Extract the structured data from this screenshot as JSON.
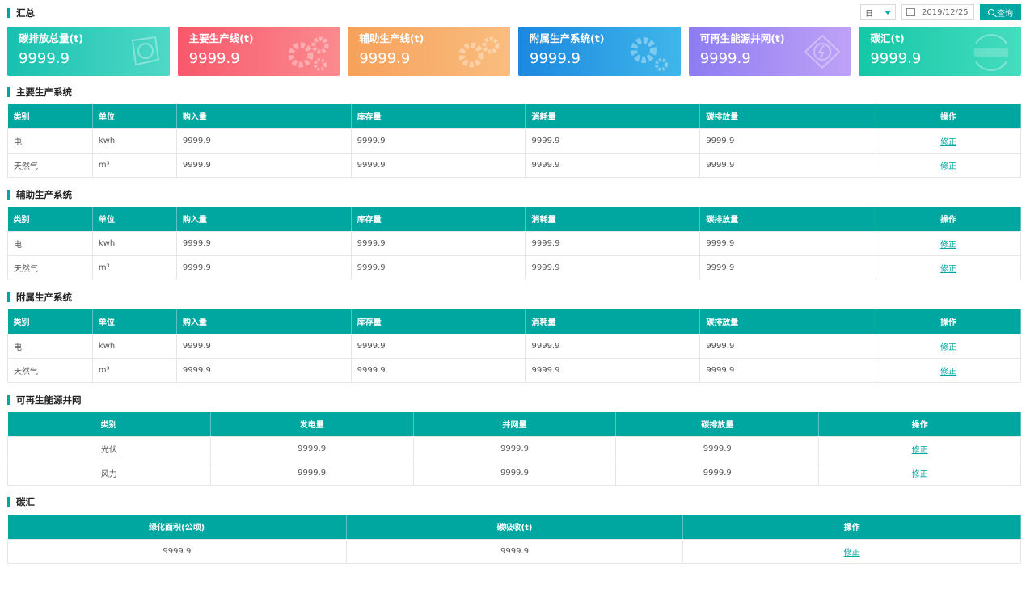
{
  "summary": {
    "title": "汇总",
    "period_select": "日",
    "date": "2019/12/25",
    "query_label": "查询",
    "cards": [
      {
        "title": "碳排放总量(t)",
        "value": "9999.9",
        "icon": "carbon-icon",
        "color": "#19c1b0"
      },
      {
        "title": "主要生产线(t)",
        "value": "9999.9",
        "icon": "gears-icon",
        "color": "#f7586a"
      },
      {
        "title": "辅助生产线(t)",
        "value": "9999.9",
        "icon": "gears-icon",
        "color": "#f7a15a"
      },
      {
        "title": "附属生产系统(t)",
        "value": "9999.9",
        "icon": "gears-icon",
        "color": "#1c88df"
      },
      {
        "title": "可再生能源并网(t)",
        "value": "9999.9",
        "icon": "energy-icon",
        "color": "#8d7cf2"
      },
      {
        "title": "碳汇(t)",
        "value": "9999.9",
        "icon": "carbon-money-icon",
        "color": "#14c7a6"
      }
    ]
  },
  "main": {
    "title": "主要生产系统",
    "headers": [
      "类别",
      "单位",
      "购入量",
      "库存量",
      "消耗量",
      "碳排放量",
      "操作"
    ],
    "rows": [
      {
        "type": "电",
        "unit": "kwh",
        "buy": "9999.9",
        "stock": "9999.9",
        "use": "9999.9",
        "carbon": "9999.9",
        "action": "修正"
      },
      {
        "type": "天然气",
        "unit": "m³",
        "buy": "9999.9",
        "stock": "9999.9",
        "use": "9999.9",
        "carbon": "9999.9",
        "action": "修正"
      }
    ]
  },
  "aux": {
    "title": "辅助生产系统",
    "headers": [
      "类别",
      "单位",
      "购入量",
      "库存量",
      "消耗量",
      "碳排放量",
      "操作"
    ],
    "rows": [
      {
        "type": "电",
        "unit": "kwh",
        "buy": "9999.9",
        "stock": "9999.9",
        "use": "9999.9",
        "carbon": "9999.9",
        "action": "修正"
      },
      {
        "type": "天然气",
        "unit": "m³",
        "buy": "9999.9",
        "stock": "9999.9",
        "use": "9999.9",
        "carbon": "9999.9",
        "action": "修正"
      }
    ]
  },
  "attached": {
    "title": "附属生产系统",
    "headers": [
      "类别",
      "单位",
      "购入量",
      "库存量",
      "消耗量",
      "碳排放量",
      "操作"
    ],
    "rows": [
      {
        "type": "电",
        "unit": "kwh",
        "buy": "9999.9",
        "stock": "9999.9",
        "use": "9999.9",
        "carbon": "9999.9",
        "action": "修正"
      },
      {
        "type": "天然气",
        "unit": "m³",
        "buy": "9999.9",
        "stock": "9999.9",
        "use": "9999.9",
        "carbon": "9999.9",
        "action": "修正"
      }
    ]
  },
  "renewable": {
    "title": "可再生能源并网",
    "headers": [
      "类别",
      "发电量",
      "并网量",
      "碳排放量",
      "操作"
    ],
    "rows": [
      {
        "type": "光伏",
        "gen": "9999.9",
        "grid": "9999.9",
        "carbon": "9999.9",
        "action": "修正"
      },
      {
        "type": "风力",
        "gen": "9999.9",
        "grid": "9999.9",
        "carbon": "9999.9",
        "action": "修正"
      }
    ]
  },
  "sink": {
    "title": "碳汇",
    "headers": [
      "绿化面积(公顷)",
      "碳吸收(t)",
      "操作"
    ],
    "rows": [
      {
        "area": "9999.9",
        "absorb": "9999.9",
        "action": "修正"
      }
    ]
  }
}
